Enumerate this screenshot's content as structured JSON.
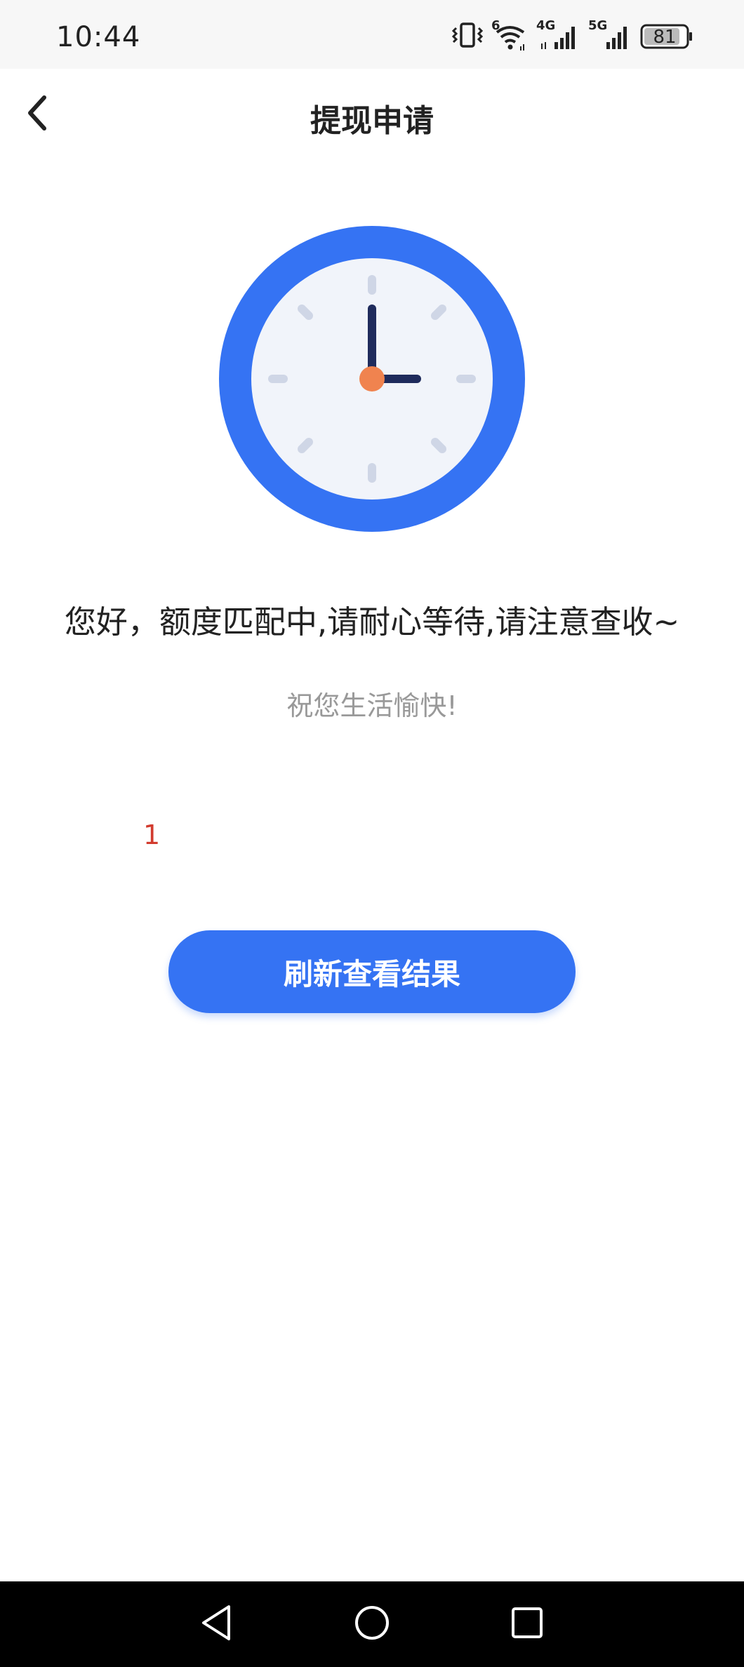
{
  "status_bar": {
    "time": "10:44",
    "battery_level": "81",
    "network_labels": {
      "wifi": "6",
      "sim1": "4G",
      "sim2": "5G"
    },
    "icons": [
      "vibrate-icon",
      "wifi-icon",
      "signal-4g-icon",
      "signal-5g-icon",
      "battery-icon"
    ]
  },
  "header": {
    "title": "提现申请",
    "back_icon": "chevron-left-icon"
  },
  "main": {
    "illustration": "clock-icon",
    "message": "您好，额度匹配中,请耐心等待,请注意查收~",
    "sub_message": "祝您生活愉快!",
    "counter": "1",
    "refresh_button_label": "刷新查看结果"
  },
  "colors": {
    "accent": "#3573F3",
    "clock_face": "#F1F4FA",
    "clock_hand": "#1F2B5C",
    "clock_center": "#F0834F",
    "counter_text": "#D23B2E",
    "muted_text": "#999999"
  },
  "system_nav": {
    "icons": [
      "back-triangle-icon",
      "home-circle-icon",
      "recents-square-icon"
    ]
  }
}
